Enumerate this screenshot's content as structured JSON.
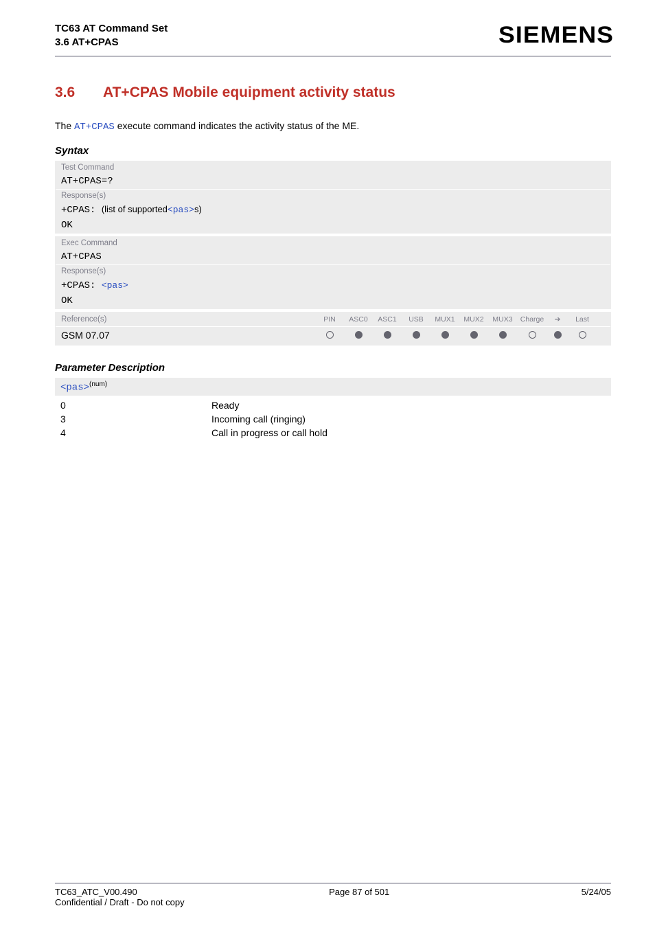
{
  "header": {
    "doc_title": "TC63 AT Command Set",
    "subsection_ref": "3.6 AT+CPAS",
    "brand": "SIEMENS"
  },
  "section": {
    "number": "3.6",
    "title": "AT+CPAS   Mobile equipment activity status",
    "intro_pre": "The ",
    "intro_cmd": "AT+CPAS",
    "intro_post": " execute command indicates the activity status of the ME."
  },
  "syntax": {
    "label": "Syntax",
    "test_cmd_label": "Test Command",
    "test_cmd": "AT+CPAS=?",
    "responses_label": "Response(s)",
    "test_resp_prefix": "+CPAS: ",
    "test_resp_text1": "(list of supported",
    "test_resp_param": "<pas>",
    "test_resp_text2": "s)",
    "ok": "OK",
    "exec_cmd_label": "Exec Command",
    "exec_cmd": "AT+CPAS",
    "exec_resp_prefix": "+CPAS: ",
    "exec_resp_param": "<pas>",
    "references_label": "Reference(s)",
    "reference_value": "GSM 07.07",
    "cols": [
      "PIN",
      "ASC0",
      "ASC1",
      "USB",
      "MUX1",
      "MUX2",
      "MUX3",
      "Charge",
      "➔",
      "Last"
    ],
    "col_states": [
      "open",
      "filled",
      "filled",
      "filled",
      "filled",
      "filled",
      "filled",
      "open",
      "filled",
      "open"
    ]
  },
  "params": {
    "label": "Parameter Description",
    "name": "<pas>",
    "type_sup": "(num)",
    "rows": [
      {
        "key": "0",
        "desc": "Ready"
      },
      {
        "key": "3",
        "desc": "Incoming call (ringing)"
      },
      {
        "key": "4",
        "desc": "Call in progress or call hold"
      }
    ]
  },
  "footer": {
    "left": "TC63_ATC_V00.490",
    "center": "Page 87 of 501",
    "right": "5/24/05",
    "confidential": "Confidential / Draft - Do not copy"
  },
  "chart_data": {
    "type": "table",
    "title": "Interface support matrix for GSM 07.07 reference",
    "columns": [
      "PIN",
      "ASC0",
      "ASC1",
      "USB",
      "MUX1",
      "MUX2",
      "MUX3",
      "Charge",
      "➔",
      "Last"
    ],
    "rows": [
      {
        "reference": "GSM 07.07",
        "values": [
          "unsupported",
          "supported",
          "supported",
          "supported",
          "supported",
          "supported",
          "supported",
          "unsupported",
          "supported",
          "unsupported"
        ]
      }
    ],
    "legend": {
      "filled_dot": "supported",
      "open_dot": "unsupported"
    }
  }
}
